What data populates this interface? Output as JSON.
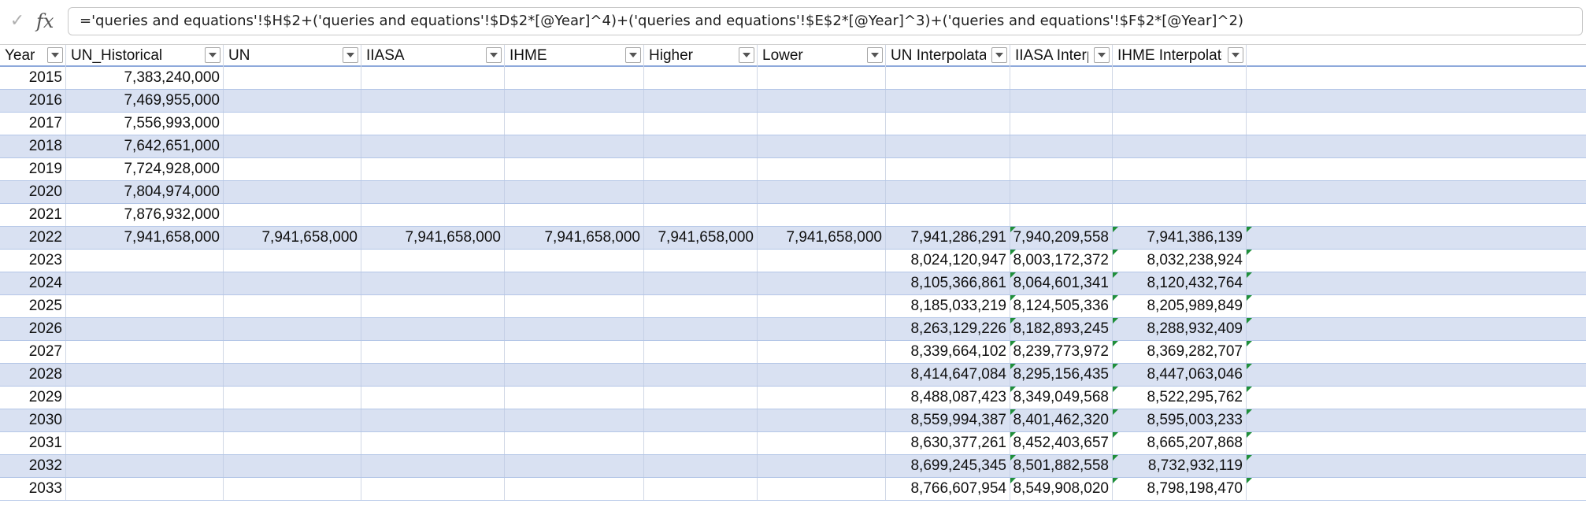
{
  "formula_bar": {
    "check_glyph": "✓",
    "fx_label": "fx",
    "formula": "='queries and equations'!$H$2+('queries and equations'!$D$2*[@Year]^4)+('queries and equations'!$E$2*[@Year]^3)+('queries and equations'!$F$2*[@Year]^2)"
  },
  "table": {
    "columns": [
      {
        "label": "Year"
      },
      {
        "label": "UN_Historical"
      },
      {
        "label": "UN"
      },
      {
        "label": "IIASA"
      },
      {
        "label": "IHME"
      },
      {
        "label": "Higher"
      },
      {
        "label": "Lower"
      },
      {
        "label": "UN Interpolataed"
      },
      {
        "label": "IIASA Interpolated"
      },
      {
        "label": "IHME Interpolated"
      }
    ],
    "rows": [
      {
        "cells": [
          "2015",
          "7,383,240,000",
          "",
          "",
          "",
          "",
          "",
          "",
          "",
          ""
        ]
      },
      {
        "cells": [
          "2016",
          "7,469,955,000",
          "",
          "",
          "",
          "",
          "",
          "",
          "",
          ""
        ]
      },
      {
        "cells": [
          "2017",
          "7,556,993,000",
          "",
          "",
          "",
          "",
          "",
          "",
          "",
          ""
        ]
      },
      {
        "cells": [
          "2018",
          "7,642,651,000",
          "",
          "",
          "",
          "",
          "",
          "",
          "",
          ""
        ]
      },
      {
        "cells": [
          "2019",
          "7,724,928,000",
          "",
          "",
          "",
          "",
          "",
          "",
          "",
          ""
        ]
      },
      {
        "cells": [
          "2020",
          "7,804,974,000",
          "",
          "",
          "",
          "",
          "",
          "",
          "",
          ""
        ]
      },
      {
        "cells": [
          "2021",
          "7,876,932,000",
          "",
          "",
          "",
          "",
          "",
          "",
          "",
          ""
        ]
      },
      {
        "cells": [
          "2022",
          "7,941,658,000",
          "7,941,658,000",
          "7,941,658,000",
          "7,941,658,000",
          "7,941,658,000",
          "7,941,658,000",
          "7,941,286,291",
          "7,940,209,558",
          "7,941,386,139"
        ]
      },
      {
        "cells": [
          "2023",
          "",
          "",
          "",
          "",
          "",
          "",
          "8,024,120,947",
          "8,003,172,372",
          "8,032,238,924"
        ]
      },
      {
        "cells": [
          "2024",
          "",
          "",
          "",
          "",
          "",
          "",
          "8,105,366,861",
          "8,064,601,341",
          "8,120,432,764"
        ]
      },
      {
        "cells": [
          "2025",
          "",
          "",
          "",
          "",
          "",
          "",
          "8,185,033,219",
          "8,124,505,336",
          "8,205,989,849"
        ]
      },
      {
        "cells": [
          "2026",
          "",
          "",
          "",
          "",
          "",
          "",
          "8,263,129,226",
          "8,182,893,245",
          "8,288,932,409"
        ]
      },
      {
        "cells": [
          "2027",
          "",
          "",
          "",
          "",
          "",
          "",
          "8,339,664,102",
          "8,239,773,972",
          "8,369,282,707"
        ]
      },
      {
        "cells": [
          "2028",
          "",
          "",
          "",
          "",
          "",
          "",
          "8,414,647,084",
          "8,295,156,435",
          "8,447,063,046"
        ]
      },
      {
        "cells": [
          "2029",
          "",
          "",
          "",
          "",
          "",
          "",
          "8,488,087,423",
          "8,349,049,568",
          "8,522,295,762"
        ]
      },
      {
        "cells": [
          "2030",
          "",
          "",
          "",
          "",
          "",
          "",
          "8,559,994,387",
          "8,401,462,320",
          "8,595,003,233"
        ]
      },
      {
        "cells": [
          "2031",
          "",
          "",
          "",
          "",
          "",
          "",
          "8,630,377,261",
          "8,452,403,657",
          "8,665,207,868"
        ]
      },
      {
        "cells": [
          "2032",
          "",
          "",
          "",
          "",
          "",
          "",
          "8,699,245,345",
          "8,501,882,558",
          "8,732,932,119"
        ]
      },
      {
        "cells": [
          "2033",
          "",
          "",
          "",
          "",
          "",
          "",
          "8,766,607,954",
          "8,549,908,020",
          "8,798,198,470"
        ]
      }
    ]
  }
}
